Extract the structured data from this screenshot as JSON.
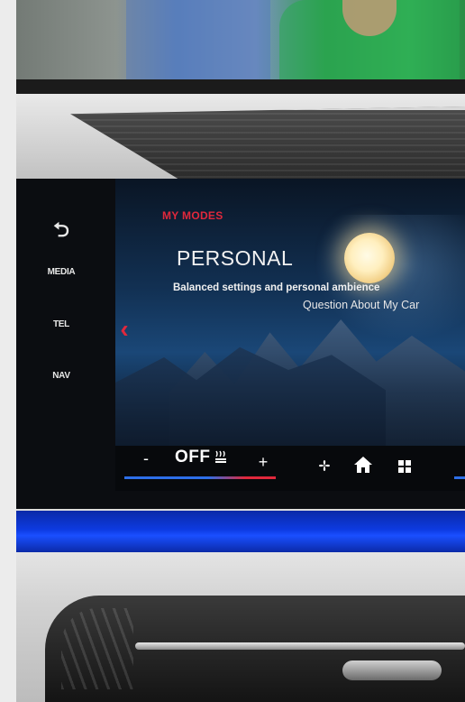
{
  "rail": {
    "back_icon": "back-arrow-icon",
    "media_label": "MEDIA",
    "tel_label": "TEL",
    "nav_label": "NAV"
  },
  "content": {
    "section_label": "MY MODES",
    "mode_title": "PERSONAL",
    "mode_description": "Balanced settings and personal ambience",
    "assistant_prompt": "Question About My Car"
  },
  "climate": {
    "minus_label": "-",
    "temperature_value": "OFF",
    "plus_label": "+",
    "seat_heat_icon": "seat-heat-icon"
  },
  "bottom_icons": [
    "fan-icon",
    "home-icon",
    "apps-icon"
  ],
  "colors": {
    "accent_red": "#e0283c",
    "accent_blue": "#2d6fe8",
    "ambient_blue": "#0d3ae0"
  }
}
